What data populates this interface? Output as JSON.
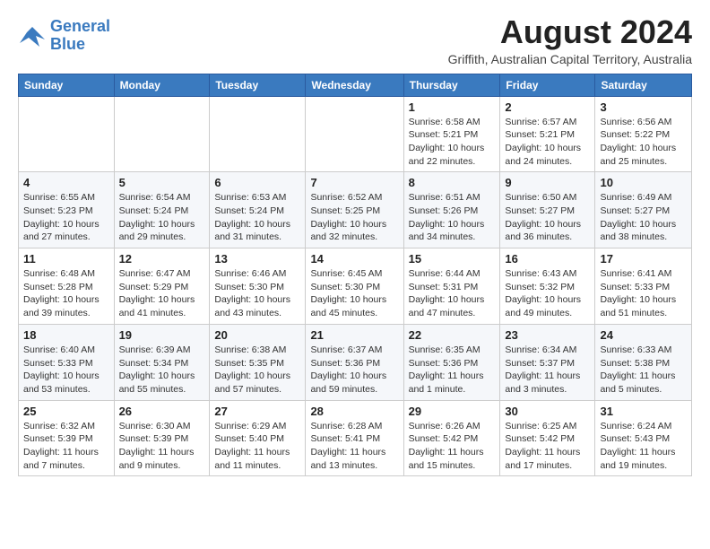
{
  "logo": {
    "line1": "General",
    "line2": "Blue"
  },
  "title": "August 2024",
  "subtitle": "Griffith, Australian Capital Territory, Australia",
  "header": {
    "columns": [
      "Sunday",
      "Monday",
      "Tuesday",
      "Wednesday",
      "Thursday",
      "Friday",
      "Saturday"
    ]
  },
  "weeks": [
    {
      "cells": [
        {
          "day": "",
          "detail": ""
        },
        {
          "day": "",
          "detail": ""
        },
        {
          "day": "",
          "detail": ""
        },
        {
          "day": "",
          "detail": ""
        },
        {
          "day": "1",
          "detail": "Sunrise: 6:58 AM\nSunset: 5:21 PM\nDaylight: 10 hours\nand 22 minutes."
        },
        {
          "day": "2",
          "detail": "Sunrise: 6:57 AM\nSunset: 5:21 PM\nDaylight: 10 hours\nand 24 minutes."
        },
        {
          "day": "3",
          "detail": "Sunrise: 6:56 AM\nSunset: 5:22 PM\nDaylight: 10 hours\nand 25 minutes."
        }
      ]
    },
    {
      "cells": [
        {
          "day": "4",
          "detail": "Sunrise: 6:55 AM\nSunset: 5:23 PM\nDaylight: 10 hours\nand 27 minutes."
        },
        {
          "day": "5",
          "detail": "Sunrise: 6:54 AM\nSunset: 5:24 PM\nDaylight: 10 hours\nand 29 minutes."
        },
        {
          "day": "6",
          "detail": "Sunrise: 6:53 AM\nSunset: 5:24 PM\nDaylight: 10 hours\nand 31 minutes."
        },
        {
          "day": "7",
          "detail": "Sunrise: 6:52 AM\nSunset: 5:25 PM\nDaylight: 10 hours\nand 32 minutes."
        },
        {
          "day": "8",
          "detail": "Sunrise: 6:51 AM\nSunset: 5:26 PM\nDaylight: 10 hours\nand 34 minutes."
        },
        {
          "day": "9",
          "detail": "Sunrise: 6:50 AM\nSunset: 5:27 PM\nDaylight: 10 hours\nand 36 minutes."
        },
        {
          "day": "10",
          "detail": "Sunrise: 6:49 AM\nSunset: 5:27 PM\nDaylight: 10 hours\nand 38 minutes."
        }
      ]
    },
    {
      "cells": [
        {
          "day": "11",
          "detail": "Sunrise: 6:48 AM\nSunset: 5:28 PM\nDaylight: 10 hours\nand 39 minutes."
        },
        {
          "day": "12",
          "detail": "Sunrise: 6:47 AM\nSunset: 5:29 PM\nDaylight: 10 hours\nand 41 minutes."
        },
        {
          "day": "13",
          "detail": "Sunrise: 6:46 AM\nSunset: 5:30 PM\nDaylight: 10 hours\nand 43 minutes."
        },
        {
          "day": "14",
          "detail": "Sunrise: 6:45 AM\nSunset: 5:30 PM\nDaylight: 10 hours\nand 45 minutes."
        },
        {
          "day": "15",
          "detail": "Sunrise: 6:44 AM\nSunset: 5:31 PM\nDaylight: 10 hours\nand 47 minutes."
        },
        {
          "day": "16",
          "detail": "Sunrise: 6:43 AM\nSunset: 5:32 PM\nDaylight: 10 hours\nand 49 minutes."
        },
        {
          "day": "17",
          "detail": "Sunrise: 6:41 AM\nSunset: 5:33 PM\nDaylight: 10 hours\nand 51 minutes."
        }
      ]
    },
    {
      "cells": [
        {
          "day": "18",
          "detail": "Sunrise: 6:40 AM\nSunset: 5:33 PM\nDaylight: 10 hours\nand 53 minutes."
        },
        {
          "day": "19",
          "detail": "Sunrise: 6:39 AM\nSunset: 5:34 PM\nDaylight: 10 hours\nand 55 minutes."
        },
        {
          "day": "20",
          "detail": "Sunrise: 6:38 AM\nSunset: 5:35 PM\nDaylight: 10 hours\nand 57 minutes."
        },
        {
          "day": "21",
          "detail": "Sunrise: 6:37 AM\nSunset: 5:36 PM\nDaylight: 10 hours\nand 59 minutes."
        },
        {
          "day": "22",
          "detail": "Sunrise: 6:35 AM\nSunset: 5:36 PM\nDaylight: 11 hours\nand 1 minute."
        },
        {
          "day": "23",
          "detail": "Sunrise: 6:34 AM\nSunset: 5:37 PM\nDaylight: 11 hours\nand 3 minutes."
        },
        {
          "day": "24",
          "detail": "Sunrise: 6:33 AM\nSunset: 5:38 PM\nDaylight: 11 hours\nand 5 minutes."
        }
      ]
    },
    {
      "cells": [
        {
          "day": "25",
          "detail": "Sunrise: 6:32 AM\nSunset: 5:39 PM\nDaylight: 11 hours\nand 7 minutes."
        },
        {
          "day": "26",
          "detail": "Sunrise: 6:30 AM\nSunset: 5:39 PM\nDaylight: 11 hours\nand 9 minutes."
        },
        {
          "day": "27",
          "detail": "Sunrise: 6:29 AM\nSunset: 5:40 PM\nDaylight: 11 hours\nand 11 minutes."
        },
        {
          "day": "28",
          "detail": "Sunrise: 6:28 AM\nSunset: 5:41 PM\nDaylight: 11 hours\nand 13 minutes."
        },
        {
          "day": "29",
          "detail": "Sunrise: 6:26 AM\nSunset: 5:42 PM\nDaylight: 11 hours\nand 15 minutes."
        },
        {
          "day": "30",
          "detail": "Sunrise: 6:25 AM\nSunset: 5:42 PM\nDaylight: 11 hours\nand 17 minutes."
        },
        {
          "day": "31",
          "detail": "Sunrise: 6:24 AM\nSunset: 5:43 PM\nDaylight: 11 hours\nand 19 minutes."
        }
      ]
    }
  ]
}
